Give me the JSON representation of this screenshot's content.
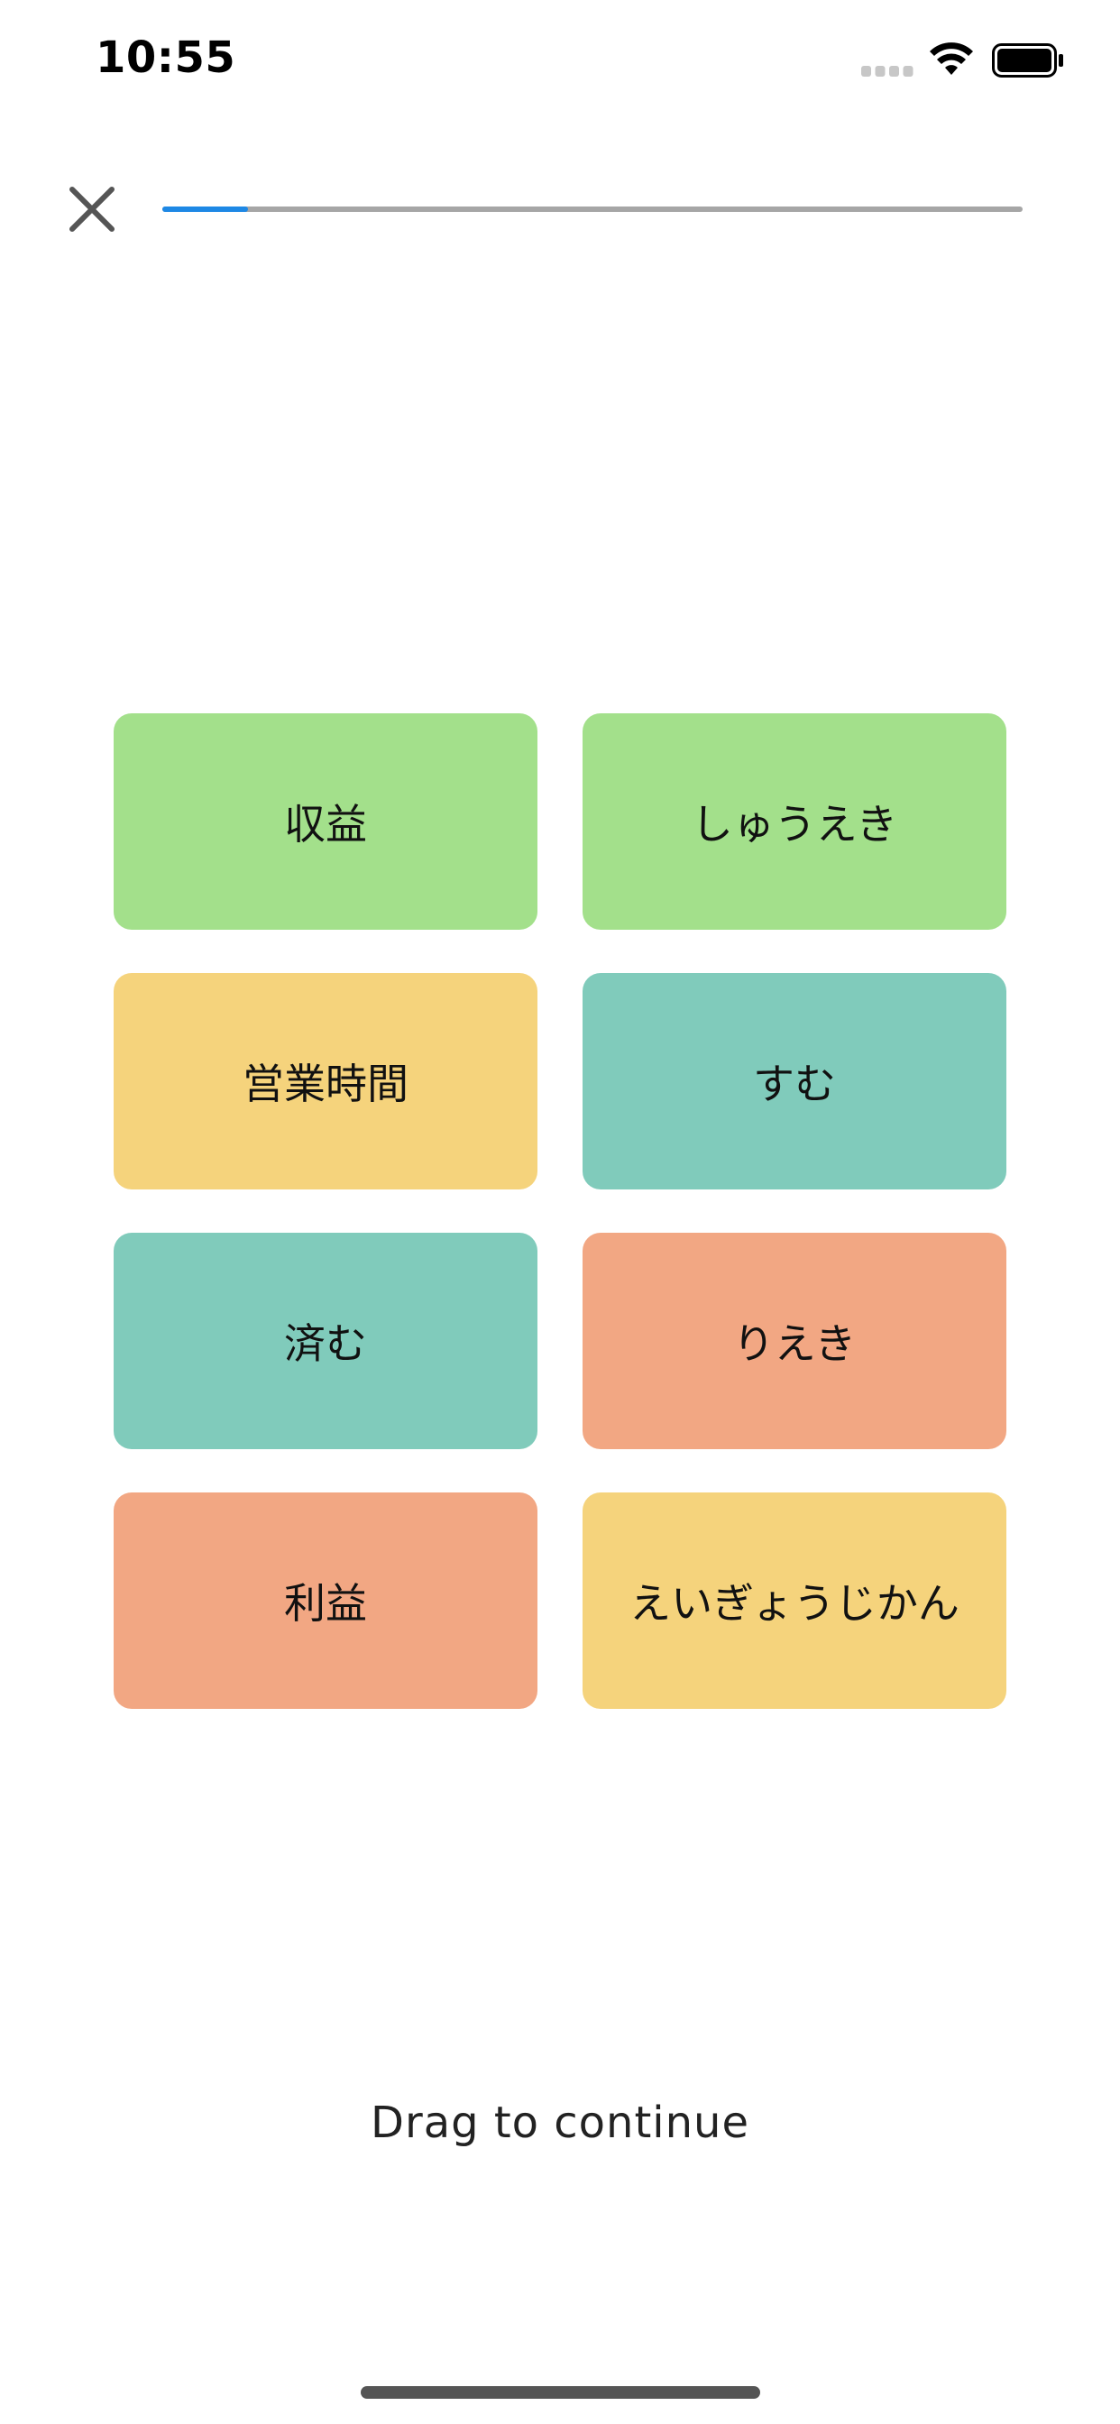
{
  "status_bar": {
    "time": "10:55",
    "icons": [
      "signal-dots-icon",
      "wifi-icon",
      "battery-icon"
    ]
  },
  "top_bar": {
    "close_icon": "close-icon",
    "progress_fraction": 0.1
  },
  "cards": [
    {
      "label": "収益",
      "color": "#a3e08b"
    },
    {
      "label": "しゅうえき",
      "color": "#a3e08b"
    },
    {
      "label": "営業時間",
      "color": "#f5d37c"
    },
    {
      "label": "すむ",
      "color": "#80cbbb"
    },
    {
      "label": "済む",
      "color": "#80cbbb"
    },
    {
      "label": "りえき",
      "color": "#f2a783"
    },
    {
      "label": "利益",
      "color": "#f2a783"
    },
    {
      "label": "えいぎょうじかん",
      "color": "#f5d37c"
    }
  ],
  "footer": {
    "hint": "Drag to continue"
  },
  "colors": {
    "accent": "#1e88e5",
    "progress_track": "#a6a6a6"
  }
}
